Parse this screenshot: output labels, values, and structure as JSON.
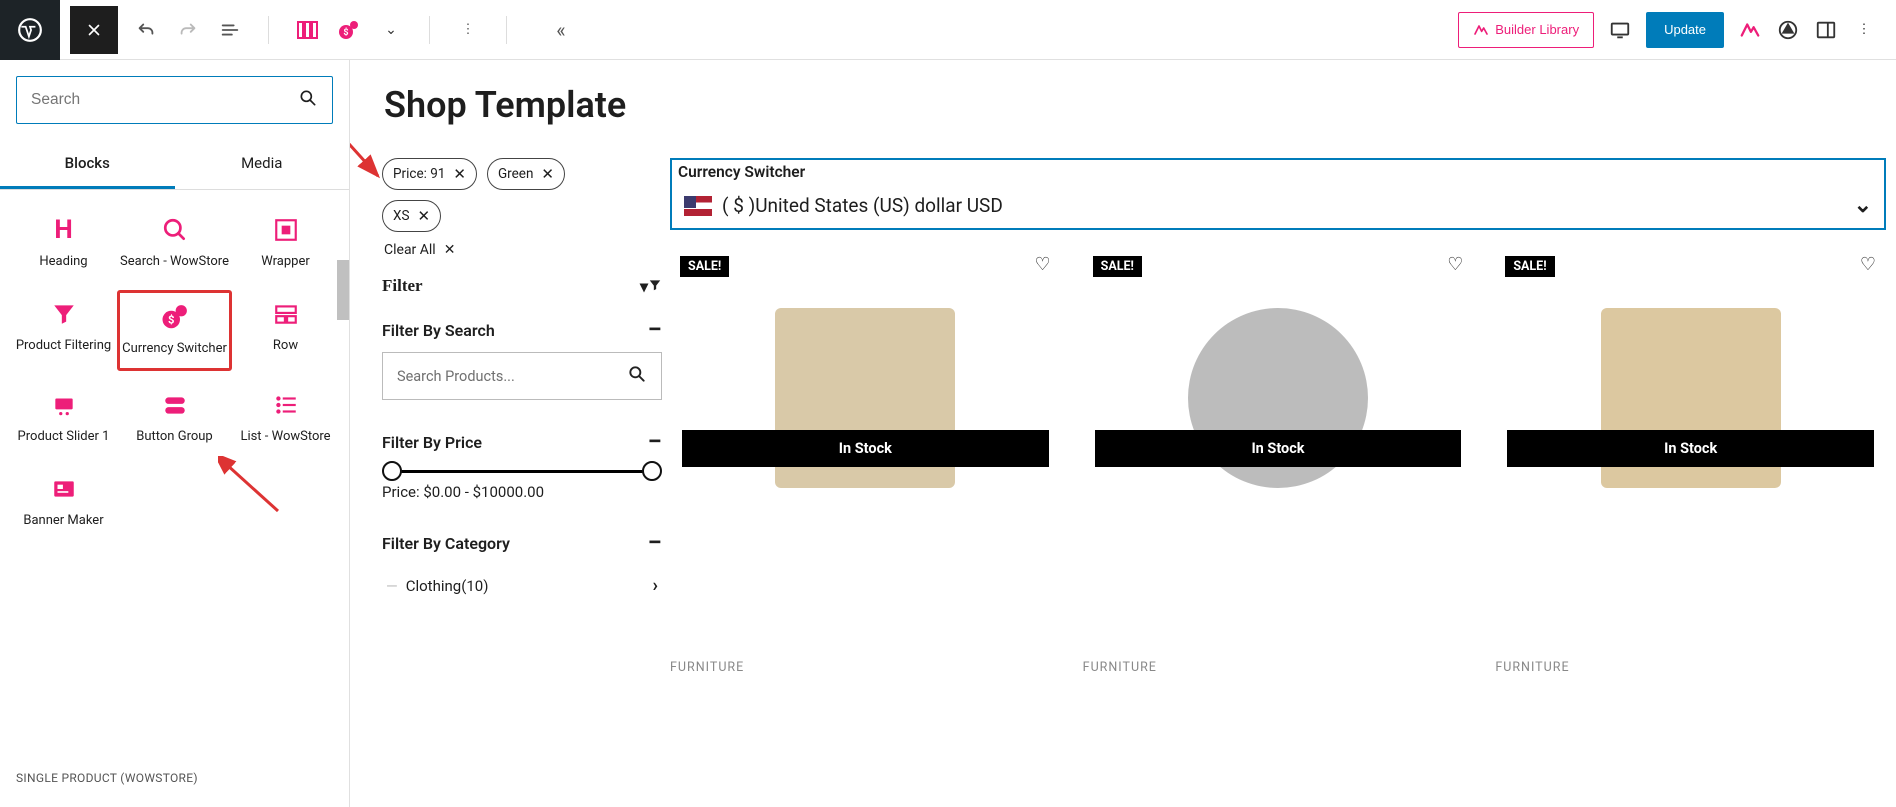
{
  "topbar": {
    "builder_library": "Builder Library",
    "update": "Update"
  },
  "sidebar": {
    "search_placeholder": "Search",
    "tabs": {
      "blocks": "Blocks",
      "media": "Media"
    },
    "blocks": [
      {
        "label": "Heading"
      },
      {
        "label": "Search - WowStore"
      },
      {
        "label": "Wrapper"
      },
      {
        "label": "Product Filtering"
      },
      {
        "label": "Currency Switcher"
      },
      {
        "label": "Row"
      },
      {
        "label": "Product Slider 1"
      },
      {
        "label": "Button Group"
      },
      {
        "label": "List - WowStore"
      },
      {
        "label": "Banner Maker"
      }
    ],
    "section_label": "SINGLE PRODUCT (WOWSTORE)"
  },
  "page": {
    "title": "Shop Template"
  },
  "filters": {
    "chips": [
      "Price: 91",
      "Green",
      "XS"
    ],
    "clear_all": "Clear All",
    "header": "Filter",
    "by_search": {
      "label": "Filter By Search",
      "placeholder": "Search Products..."
    },
    "by_price": {
      "label": "Filter By Price",
      "text": "Price: $0.00 - $10000.00"
    },
    "by_category": {
      "label": "Filter By Category",
      "item": "Clothing(10)"
    }
  },
  "currency": {
    "title": "Currency Switcher",
    "value": "( $ )United States (US) dollar USD"
  },
  "products": {
    "sale": "SALE!",
    "stock": "In Stock",
    "category": "FURNITURE"
  }
}
